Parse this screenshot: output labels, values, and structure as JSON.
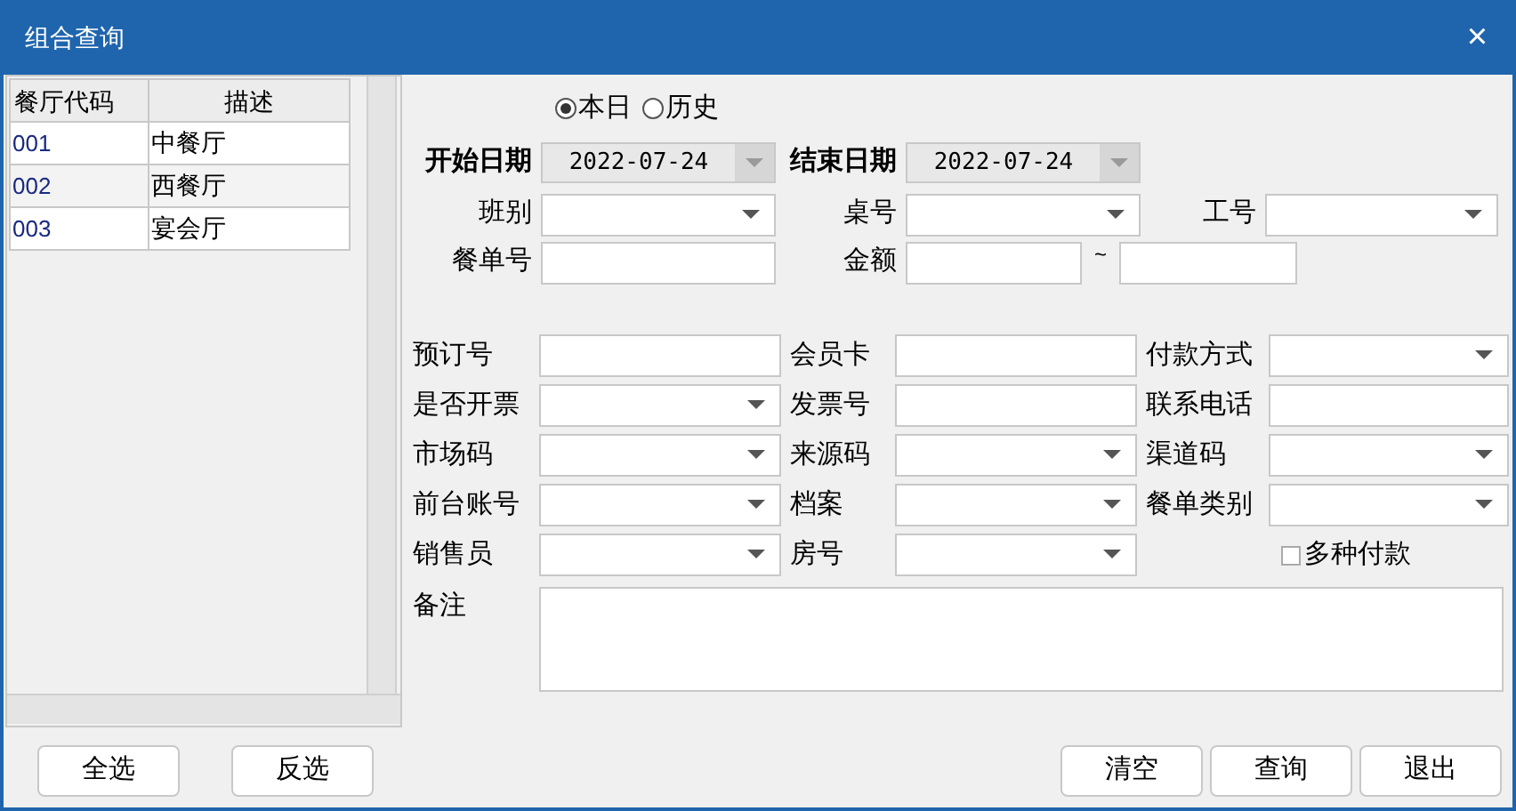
{
  "window": {
    "title": "组合查询",
    "close": "×"
  },
  "restaurant_table": {
    "columns": [
      "餐厅代码",
      "描述"
    ],
    "rows": [
      {
        "code": "001",
        "description": "中餐厅"
      },
      {
        "code": "002",
        "description": "西餐厅"
      },
      {
        "code": "003",
        "description": "宴会厅"
      }
    ]
  },
  "date_scope": [
    {
      "label": "本日",
      "selected": true
    },
    {
      "label": "历史",
      "selected": false
    }
  ],
  "top_rows": [
    [
      {
        "label": "开始日期",
        "kind": "date",
        "value": "2022-07-24",
        "disabled": true
      },
      {
        "label": "结束日期",
        "kind": "date",
        "value": "2022-07-24",
        "disabled": true
      }
    ],
    [
      {
        "label": "班别",
        "kind": "dropdown"
      },
      {
        "label": "桌号",
        "kind": "dropdown"
      },
      {
        "label": "工号",
        "kind": "dropdown"
      }
    ],
    [
      {
        "label": "餐单号",
        "kind": "text"
      },
      {
        "label": "金额",
        "kind": "range",
        "separator": "~"
      }
    ]
  ],
  "detail_rows": [
    [
      {
        "label": "预订号",
        "kind": "text"
      },
      {
        "label": "会员卡",
        "kind": "text"
      },
      {
        "label": "付款方式",
        "kind": "dropdown"
      }
    ],
    [
      {
        "label": "是否开票",
        "kind": "dropdown"
      },
      {
        "label": "发票号",
        "kind": "text"
      },
      {
        "label": "联系电话",
        "kind": "text"
      }
    ],
    [
      {
        "label": "市场码",
        "kind": "dropdown"
      },
      {
        "label": "来源码",
        "kind": "dropdown"
      },
      {
        "label": "渠道码",
        "kind": "dropdown"
      }
    ],
    [
      {
        "label": "前台账号",
        "kind": "dropdown"
      },
      {
        "label": "档案",
        "kind": "dropdown"
      },
      {
        "label": "餐单类别",
        "kind": "dropdown"
      }
    ],
    [
      {
        "label": "销售员",
        "kind": "dropdown"
      },
      {
        "label": "房号",
        "kind": "dropdown"
      },
      {
        "label": "多种付款",
        "kind": "checkbox",
        "checked": false
      }
    ]
  ],
  "remarks": {
    "label": "备注"
  },
  "left_buttons": [
    "全选",
    "反选"
  ],
  "right_buttons": [
    "清空",
    "查询",
    "退出"
  ]
}
